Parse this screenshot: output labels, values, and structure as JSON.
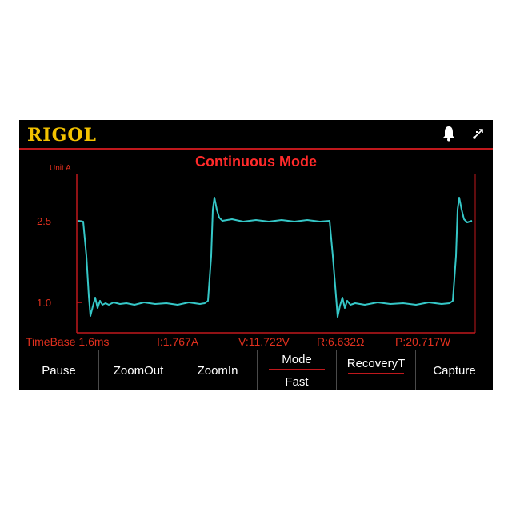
{
  "header": {
    "brand": "RIGOL",
    "title": "Continuous Mode",
    "icons": [
      "bell-icon",
      "usb-icon"
    ]
  },
  "plot": {
    "unit_label": "Unit A",
    "y_ticks": [
      "2.5",
      "1.0"
    ],
    "colors": {
      "trace": "#35c7c7",
      "axis": "#c0181c",
      "text": "#e0301e"
    }
  },
  "chart_data": {
    "type": "line",
    "ylabel": "Unit A",
    "y_ticks": [
      2.5,
      1.0
    ],
    "series": [
      {
        "values_description": "square wave",
        "x": [
          0,
          0.6,
          1.2,
          1.8,
          2.4,
          3.0,
          3.6,
          4.2,
          4.8,
          5.4,
          6.0,
          6.6,
          7.2,
          7.8,
          8.4,
          9.0,
          9.6
        ],
        "y": [
          2.5,
          2.5,
          1.0,
          1.0,
          1.0,
          1.0,
          1.0,
          2.5,
          2.5,
          2.5,
          2.5,
          2.5,
          1.0,
          1.0,
          1.0,
          1.0,
          2.5
        ]
      }
    ]
  },
  "status": {
    "timebase": "TimeBase 1.6ms",
    "current": "I:1.767A",
    "voltage": "V:11.722V",
    "resistance": "R:6.632Ω",
    "power": "P:20.717W"
  },
  "softkeys": [
    {
      "label": "Pause"
    },
    {
      "label": "ZoomOut"
    },
    {
      "label": "ZoomIn"
    },
    {
      "label": "Mode",
      "value": "Fast"
    },
    {
      "label": "RecoveryT"
    },
    {
      "label": "Capture"
    }
  ]
}
